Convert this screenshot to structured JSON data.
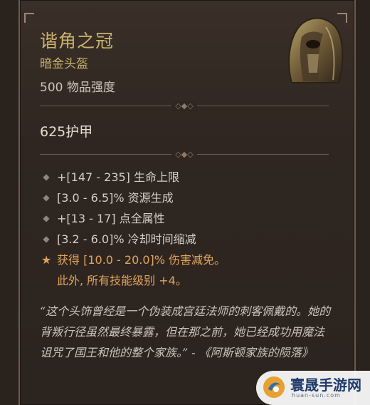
{
  "item": {
    "name": "谐角之冠",
    "type": "暗金头盔",
    "power": "500 物品强度",
    "armor": "625护甲",
    "icon": "helmet-icon"
  },
  "stats": [
    {
      "bullet": "◆",
      "text": "+[147 - 235] 生命上限"
    },
    {
      "bullet": "◆",
      "text": "[3.0 - 6.5]% 资源生成"
    },
    {
      "bullet": "◆",
      "text": "+[13 - 17] 点全属性"
    },
    {
      "bullet": "◆",
      "text": "[3.2 - 6.0]% 冷却时间缩减"
    }
  ],
  "legendary": {
    "bullet": "★",
    "line1": "获得 [10.0 - 20.0]% 伤害减免。",
    "line2": "此外, 所有技能级别 +4。"
  },
  "flavor": "“这个头饰曾经是一个伪装成宫廷法师的刺客佩戴的。她的背叛行径虽然最终暴露，但在那之前，她已经成功用魔法诅咒了国王和他的整个家族。” - 《阿斯顿家族的陨落》",
  "watermark": {
    "text": "寰晟手游网",
    "url": "huan-sun.com"
  },
  "colors": {
    "unique": "#c9b36b",
    "legendary": "#e0a45c",
    "text": "#d6cfc7"
  }
}
